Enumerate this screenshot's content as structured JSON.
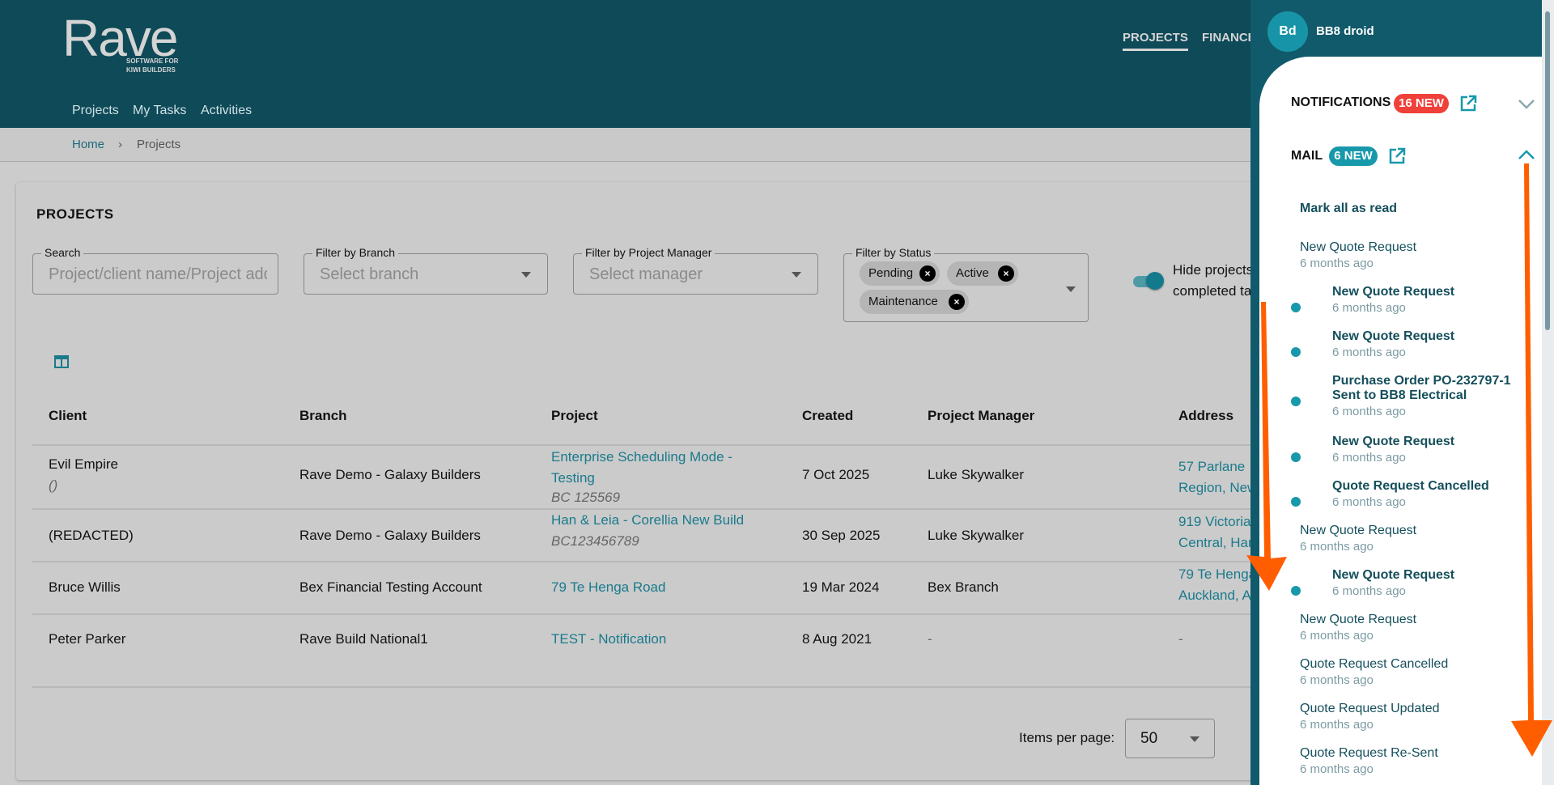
{
  "header": {
    "logo": "Rave",
    "logo_tagline_1": "SOFTWARE FOR",
    "logo_tagline_2": "KIWI BUILDERS",
    "top_nav": [
      "PROJECTS",
      "FINANCE"
    ],
    "sub_nav": [
      "Projects",
      "My Tasks",
      "Activities"
    ]
  },
  "breadcrumb": {
    "home": "Home",
    "separator": "›",
    "current": "Projects"
  },
  "page": {
    "title": "PROJECTS",
    "filters": {
      "search_label": "Search",
      "search_placeholder": "Project/client name/Project address",
      "branch_label": "Filter by Branch",
      "branch_placeholder": "Select branch",
      "manager_label": "Filter by Project Manager",
      "manager_placeholder": "Select manager",
      "status_label": "Filter by Status",
      "status_chips": [
        "Pending",
        "Active",
        "Maintenance"
      ],
      "hide_toggle_line1": "Hide projects",
      "hide_toggle_line2": "completed ta",
      "hide_toggle_on": true
    },
    "table": {
      "columns": [
        "Client",
        "Branch",
        "Project",
        "Created",
        "Project Manager",
        "Address"
      ],
      "rows": [
        {
          "client": "Evil Empire",
          "client_sub": "()",
          "branch": "Rave Demo - Galaxy Builders",
          "project_1": "Enterprise Scheduling Mode -",
          "project_2": "Testing",
          "project_code": "BC 125569",
          "created": "7 Oct 2025",
          "manager": "Luke Skywalker",
          "address_1": "57 Parlane",
          "address_2": "Region, New"
        },
        {
          "client": "(REDACTED)",
          "branch": "Rave Demo - Galaxy Builders",
          "project_1": "Han & Leia - Corellia New Build",
          "project_code": "BC123456789",
          "created": "30 Sep 2025",
          "manager": "Luke Skywalker",
          "address_1": "919 Victoria",
          "address_2": "Central, Ham"
        },
        {
          "client": "Bruce Willis",
          "branch": "Bex Financial Testing Account",
          "project_1": "79 Te Henga Road",
          "created": "19 Mar 2024",
          "manager": "Bex Branch",
          "address_1": "79 Te Henga",
          "address_2": "Auckland, A"
        },
        {
          "client": "Peter Parker",
          "branch": "Rave Build National1",
          "project_1": "TEST - Notification",
          "created": "8 Aug 2021",
          "manager": "-",
          "address_1": "-"
        }
      ]
    },
    "pagination": {
      "items_per_page_label": "Items per page:",
      "items_per_page": "50"
    }
  },
  "panel": {
    "avatar_initials": "Bd",
    "user_name": "BB8 droid",
    "notifications_label": "NOTIFICATIONS",
    "notifications_badge": "16 NEW",
    "mail_label": "MAIL",
    "mail_badge": "6 NEW",
    "mark_all": "Mark all as read",
    "mail_items": [
      {
        "title": "New Quote Request",
        "time": "6 months ago",
        "unread": false
      },
      {
        "title": "New Quote Request",
        "time": "6 months ago",
        "unread": true
      },
      {
        "title": "New Quote Request",
        "time": "6 months ago",
        "unread": true
      },
      {
        "title": "Purchase Order PO-232797-1",
        "title_2": "Sent to BB8 Electrical",
        "time": "6 months ago",
        "unread": true
      },
      {
        "title": "New Quote Request",
        "time": "6 months ago",
        "unread": true
      },
      {
        "title": "Quote Request Cancelled",
        "time": "6 months ago",
        "unread": true
      },
      {
        "title": "New Quote Request",
        "time": "6 months ago",
        "unread": false
      },
      {
        "title": "New Quote Request",
        "time": "6 months ago",
        "unread": true
      },
      {
        "title": "New Quote Request",
        "time": "6 months ago",
        "unread": false
      },
      {
        "title": "Quote Request Cancelled",
        "time": "6 months ago",
        "unread": false
      },
      {
        "title": "Quote Request Updated",
        "time": "6 months ago",
        "unread": false
      },
      {
        "title": "Quote Request Re-Sent",
        "time": "6 months ago",
        "unread": false
      }
    ]
  },
  "colors": {
    "header": "#0e4a58",
    "panel": "#115a6b",
    "accent": "#1898ab",
    "notif_badge": "#f0403a",
    "annotation": "#ff5e00"
  }
}
